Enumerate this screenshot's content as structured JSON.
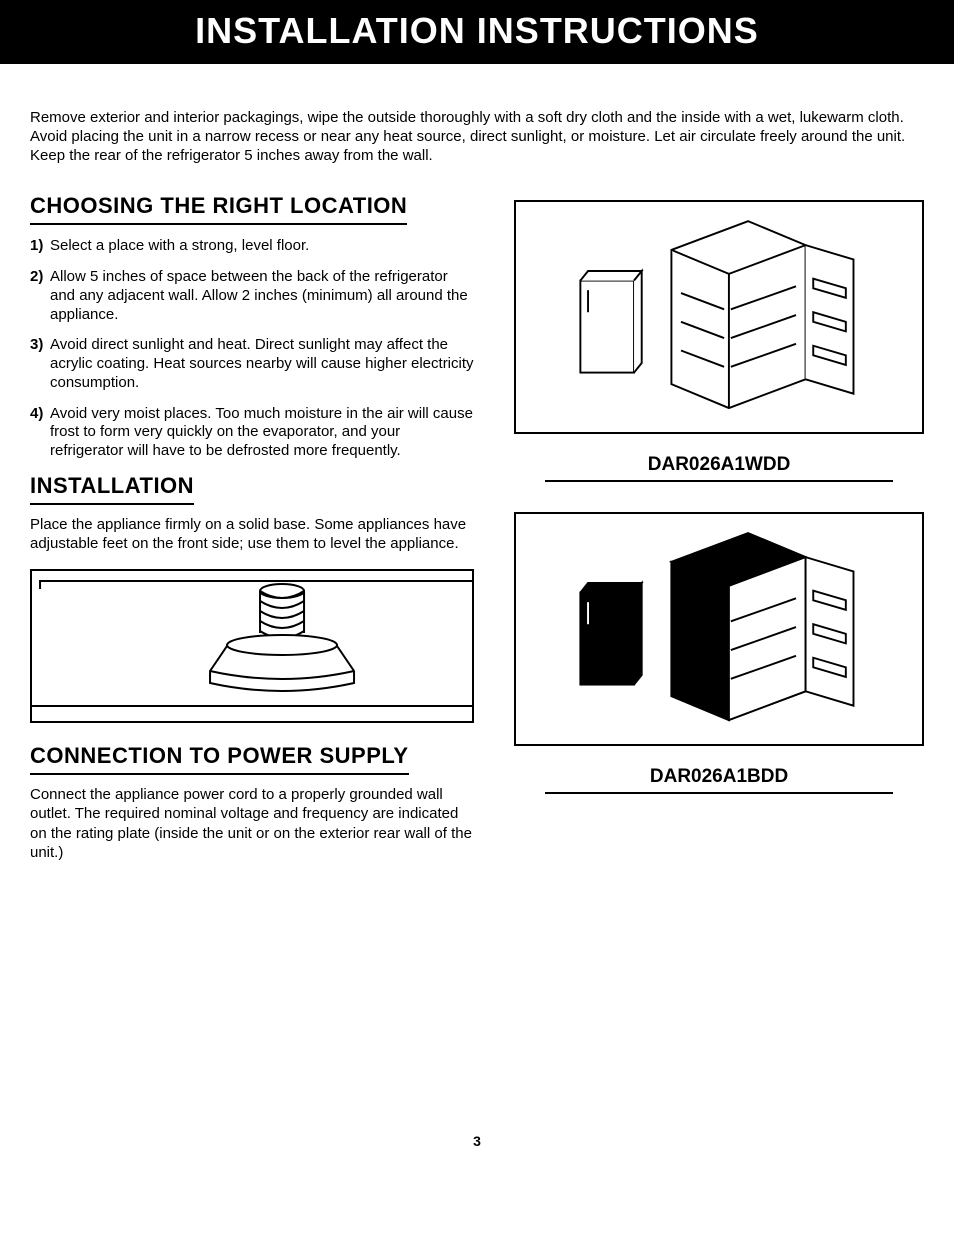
{
  "title": "INSTALLATION INSTRUCTIONS",
  "intro": "Remove exterior and interior packagings, wipe the outside thoroughly with a soft dry cloth and the inside with a wet, lukewarm cloth.  Avoid placing the unit in a narrow recess or near any heat source, direct sunlight, or moisture.  Let air circulate freely around the unit.  Keep the rear of the refrigerator 5 inches away from the wall.",
  "sections": {
    "choosing_location": {
      "heading": "CHOOSING THE RIGHT LOCATION",
      "items": [
        "Select a place with a strong, level floor.",
        "Allow 5 inches of space between the back of the refrigerator and any adjacent wall. Allow 2 inches (minimum) all around the appliance.",
        "Avoid direct sunlight and heat. Direct sunlight may affect the acrylic coating.  Heat sources nearby will cause higher electricity consumption.",
        "Avoid very moist places. Too much moisture in the air will cause frost to form very quickly on the evaporator, and your refrigerator will have to be defrosted more frequently."
      ]
    },
    "installation": {
      "heading": "INSTALLATION",
      "body": "Place the appliance firmly on a solid base. Some appliances have adjustable feet on the front side; use them to level the appliance."
    },
    "power": {
      "heading": "CONNECTION TO POWER SUPPLY",
      "body": "Connect the appliance power cord to a properly grounded wall outlet. The required nominal voltage and frequency are indicated on the rating plate (inside the unit or on the exterior rear wall of the unit.)"
    }
  },
  "models": {
    "white": "DAR026A1WDD",
    "black": "DAR026A1BDD"
  },
  "page_number": "3",
  "markers": [
    "1)",
    "2)",
    "3)",
    "4)"
  ]
}
